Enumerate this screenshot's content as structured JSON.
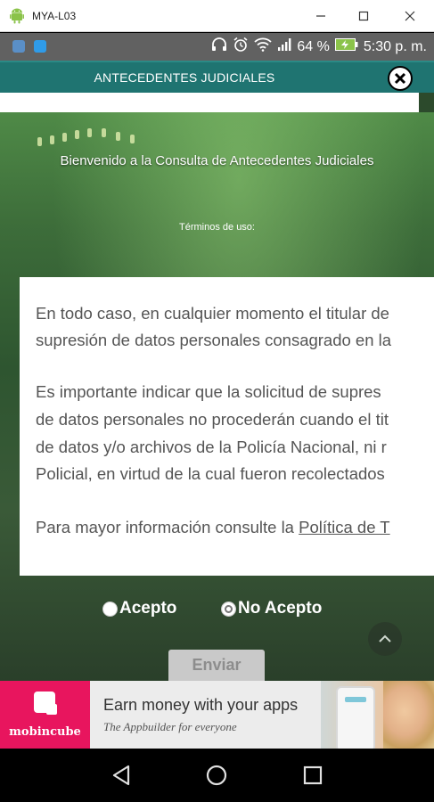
{
  "window": {
    "title": "MYA-L03"
  },
  "status_bar": {
    "battery": "64 %",
    "time": "5:30 p. m."
  },
  "app": {
    "header_title": "ANTECEDENTES JUDICIALES",
    "welcome": "Bienvenido a la Consulta de Antecedentes Judiciales",
    "terms_label": "Términos de uso:",
    "terms_lines": [
      "En todo caso, en cualquier momento el titular de",
      "supresión de datos personales consagrado en la",
      "Es importante indicar que la solicitud de supres",
      "de datos personales no procederán cuando el tit",
      "de datos y/o archivos de la Policía Nacional, ni r",
      "Policial, en virtud de la cual fueron recolectados"
    ],
    "more_info_prefix": "Para mayor información consulte la ",
    "more_info_link": "Política de T",
    "accept_label": "Acepto",
    "decline_label": "No Acepto",
    "submit_label": "Enviar"
  },
  "ad": {
    "brand": "mobincube",
    "headline": "Earn money with your apps",
    "subline": "The Appbuilder for everyone"
  },
  "colors": {
    "app_bar": "#1f7471",
    "status_bar": "#616161",
    "ad_brand": "#e8155e",
    "battery": "#8bc34a"
  }
}
